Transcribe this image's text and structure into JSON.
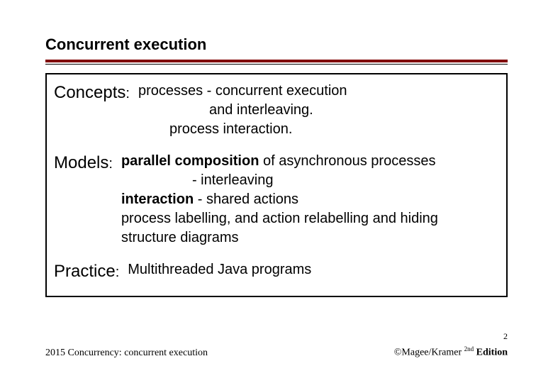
{
  "title": "Concurrent execution",
  "concepts": {
    "label": "Concepts",
    "line1": "processes - concurrent execution",
    "line2": "and interleaving.",
    "line3": "process interaction."
  },
  "models": {
    "label": "Models",
    "pc_bold": "parallel composition",
    "pc_rest": " of asynchronous processes",
    "line2": "- interleaving",
    "inter_bold": "interaction",
    "inter_rest": " - shared actions",
    "line4": "process labelling, and action relabelling and hiding",
    "line5": "structure diagrams"
  },
  "practice": {
    "label": "Practice",
    "text": "Multithreaded Java programs"
  },
  "page_number": "2",
  "footer_left": "2015  Concurrency: concurrent execution",
  "footer_right_prefix": "©Magee/Kramer ",
  "footer_right_sup": "2nd",
  "footer_right_suffix": " Edition"
}
